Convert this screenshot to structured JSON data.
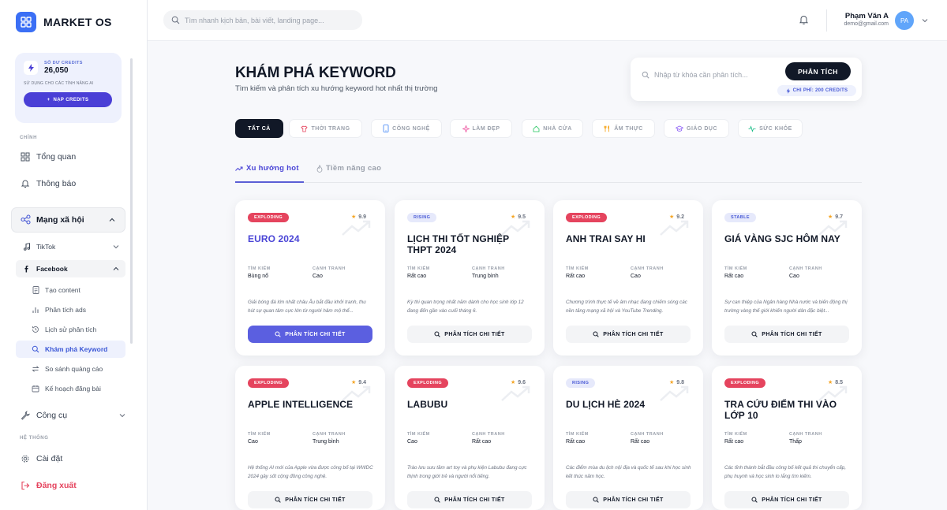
{
  "brand": {
    "name": "MARKET OS"
  },
  "credits": {
    "label": "SỐ DƯ CREDITS",
    "value": "26,050",
    "sub": "SỬ DỤNG CHO CÁC TÍNH NĂNG AI",
    "button": "NẠP CREDITS"
  },
  "nav": {
    "section_main": "CHÍNH",
    "overview": "Tổng quan",
    "notifications": "Thông báo",
    "social": "Mạng xã hội",
    "tiktok": "TikTok",
    "facebook": "Facebook",
    "fb_items": [
      "Tạo content",
      "Phân tích ads",
      "Lịch sử phân tích",
      "Khám phá Keyword",
      "So sánh quảng cáo",
      "Kế hoạch đăng bài"
    ],
    "tools": "Công cụ",
    "section_system": "HỆ THỐNG",
    "settings": "Cài đặt",
    "logout": "Đăng xuất"
  },
  "header": {
    "search_placeholder": "Tìm nhanh kịch bản, bài viết, landing page...",
    "user_name": "Phạm Văn A",
    "user_email": "demo@gmail.com",
    "avatar_initials": "PA"
  },
  "page": {
    "title": "KHÁM PHÁ KEYWORD",
    "subtitle": "Tìm kiếm và phân tích xu hướng keyword hot nhất thị trường",
    "kw_placeholder": "Nhập từ khóa cần phân tích...",
    "analyze_button": "PHÂN TÍCH",
    "cost_badge": "CHI PHÍ: 200 CREDITS"
  },
  "categories": [
    "TẤT CẢ",
    "THỜI TRANG",
    "CÔNG NGHỆ",
    "LÀM ĐẸP",
    "NHÀ CỬA",
    "ẨM THỰC",
    "GIÁO DỤC",
    "SỨC KHỎE"
  ],
  "trend_tabs": [
    "Xu hướng hot",
    "Tiềm năng cao"
  ],
  "metric_labels": {
    "search": "TÌM KIẾM",
    "competition": "CẠNH TRANH"
  },
  "card_button": "PHÂN TÍCH CHI TIẾT",
  "colors": {
    "accent": "#5b5fe0",
    "exploding": "#e5445e",
    "dark": "#111827"
  },
  "cards": [
    {
      "badge": "EXPLODING",
      "score": "9.9",
      "title": "EURO 2024",
      "search": "Bùng nổ",
      "competition": "Cao",
      "desc": "Giải bóng đá lớn nhất châu Âu bắt đầu khởi tranh, thu hút sự quan tâm cực lớn từ người hâm mộ thể..."
    },
    {
      "badge": "RISING",
      "score": "9.5",
      "title": "LỊCH THI TỐT NGHIỆP THPT 2024",
      "search": "Rất cao",
      "competition": "Trung bình",
      "desc": "Kỳ thi quan trọng nhất năm dành cho học sinh lớp 12 đang đến gần vào cuối tháng 6."
    },
    {
      "badge": "EXPLODING",
      "score": "9.2",
      "title": "ANH TRAI SAY HI",
      "search": "Rất cao",
      "competition": "Cao",
      "desc": "Chương trình thực tế về âm nhạc đang chiếm sóng các nền tảng mạng xã hội và YouTube Trending."
    },
    {
      "badge": "STABLE",
      "score": "9.7",
      "title": "GIÁ VÀNG SJC HÔM NAY",
      "search": "Rất cao",
      "competition": "Cao",
      "desc": "Sự can thiệp của Ngân hàng Nhà nước và biến động thị trường vàng thế giới khiến người dân đặc biệt..."
    },
    {
      "badge": "EXPLODING",
      "score": "9.4",
      "title": "APPLE INTELLIGENCE",
      "search": "Cao",
      "competition": "Trung bình",
      "desc": "Hệ thống AI mới của Apple vừa được công bố tại WWDC 2024 gây sốt cộng đồng công nghệ."
    },
    {
      "badge": "EXPLODING",
      "score": "9.6",
      "title": "LABUBU",
      "search": "Cao",
      "competition": "Rất cao",
      "desc": "Trào lưu sưu tầm art toy và phụ kiện Labubu đang cực thịnh trong giới trẻ và người nổi tiếng."
    },
    {
      "badge": "RISING",
      "score": "9.8",
      "title": "DU LỊCH HÈ 2024",
      "search": "Rất cao",
      "competition": "Rất cao",
      "desc": "Các điểm mùa du lịch nội địa và quốc tế sau khi học sinh kết thúc năm học."
    },
    {
      "badge": "EXPLODING",
      "score": "8.5",
      "title": "TRA CỨU ĐIỂM THI VÀO LỚP 10",
      "search": "Rất cao",
      "competition": "Thấp",
      "desc": "Các tỉnh thành bắt đầu công bố kết quả thi chuyển cấp, phụ huynh và học sinh lo lắng tìm kiếm."
    }
  ]
}
